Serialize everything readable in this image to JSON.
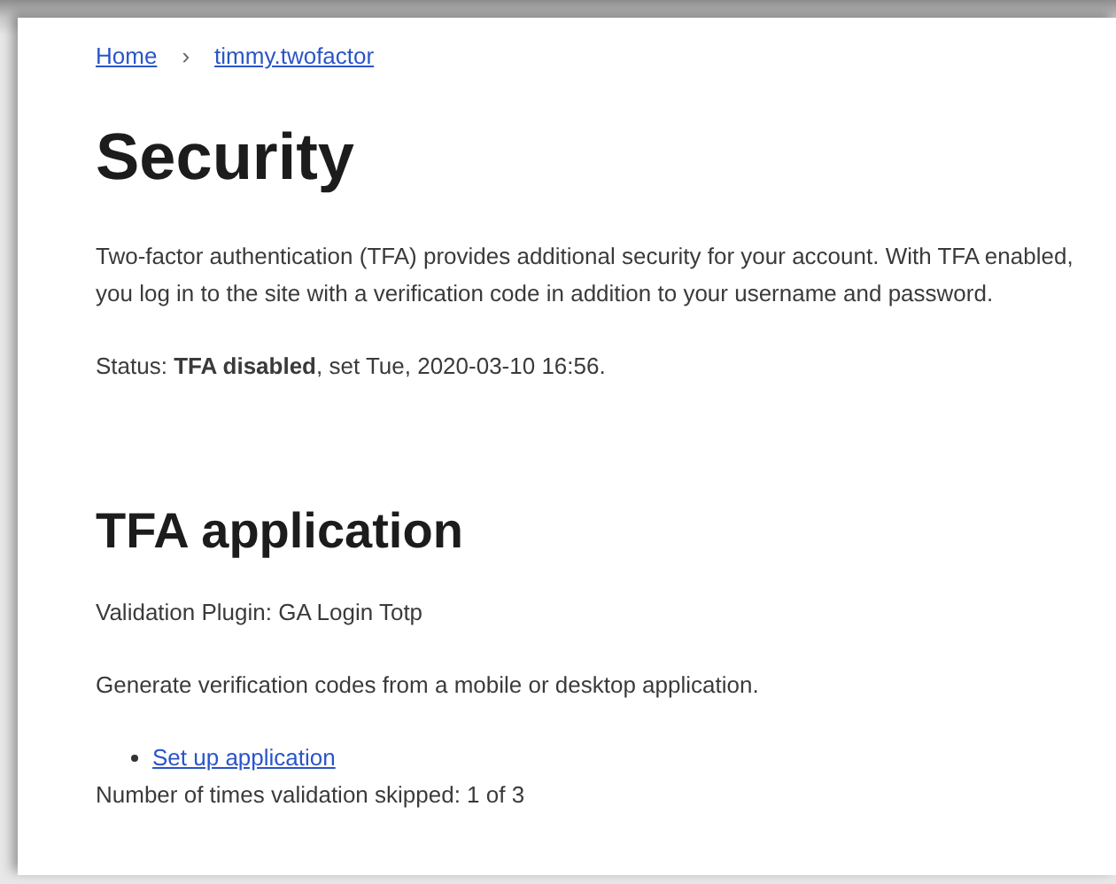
{
  "breadcrumb": [
    {
      "label": "Home"
    },
    {
      "label": "timmy.twofactor"
    }
  ],
  "breadcrumb_separator": "›",
  "title": "Security",
  "intro": "Two-factor authentication (TFA) provides additional security for your account. With TFA enabled, you log in to the site with a verification code in addition to your username and password.",
  "status": "Status: **TFA disabled**, set Tue, 2020-03-10 16:56.",
  "section": {
    "title": "TFA application",
    "plugin": "Validation Plugin: GA Login Totp",
    "description": "Generate verification codes from a mobile or desktop application.",
    "links": [
      {
        "label": "Set up application"
      }
    ],
    "skipped": "Number of times validation skipped: 1 of 3"
  }
}
